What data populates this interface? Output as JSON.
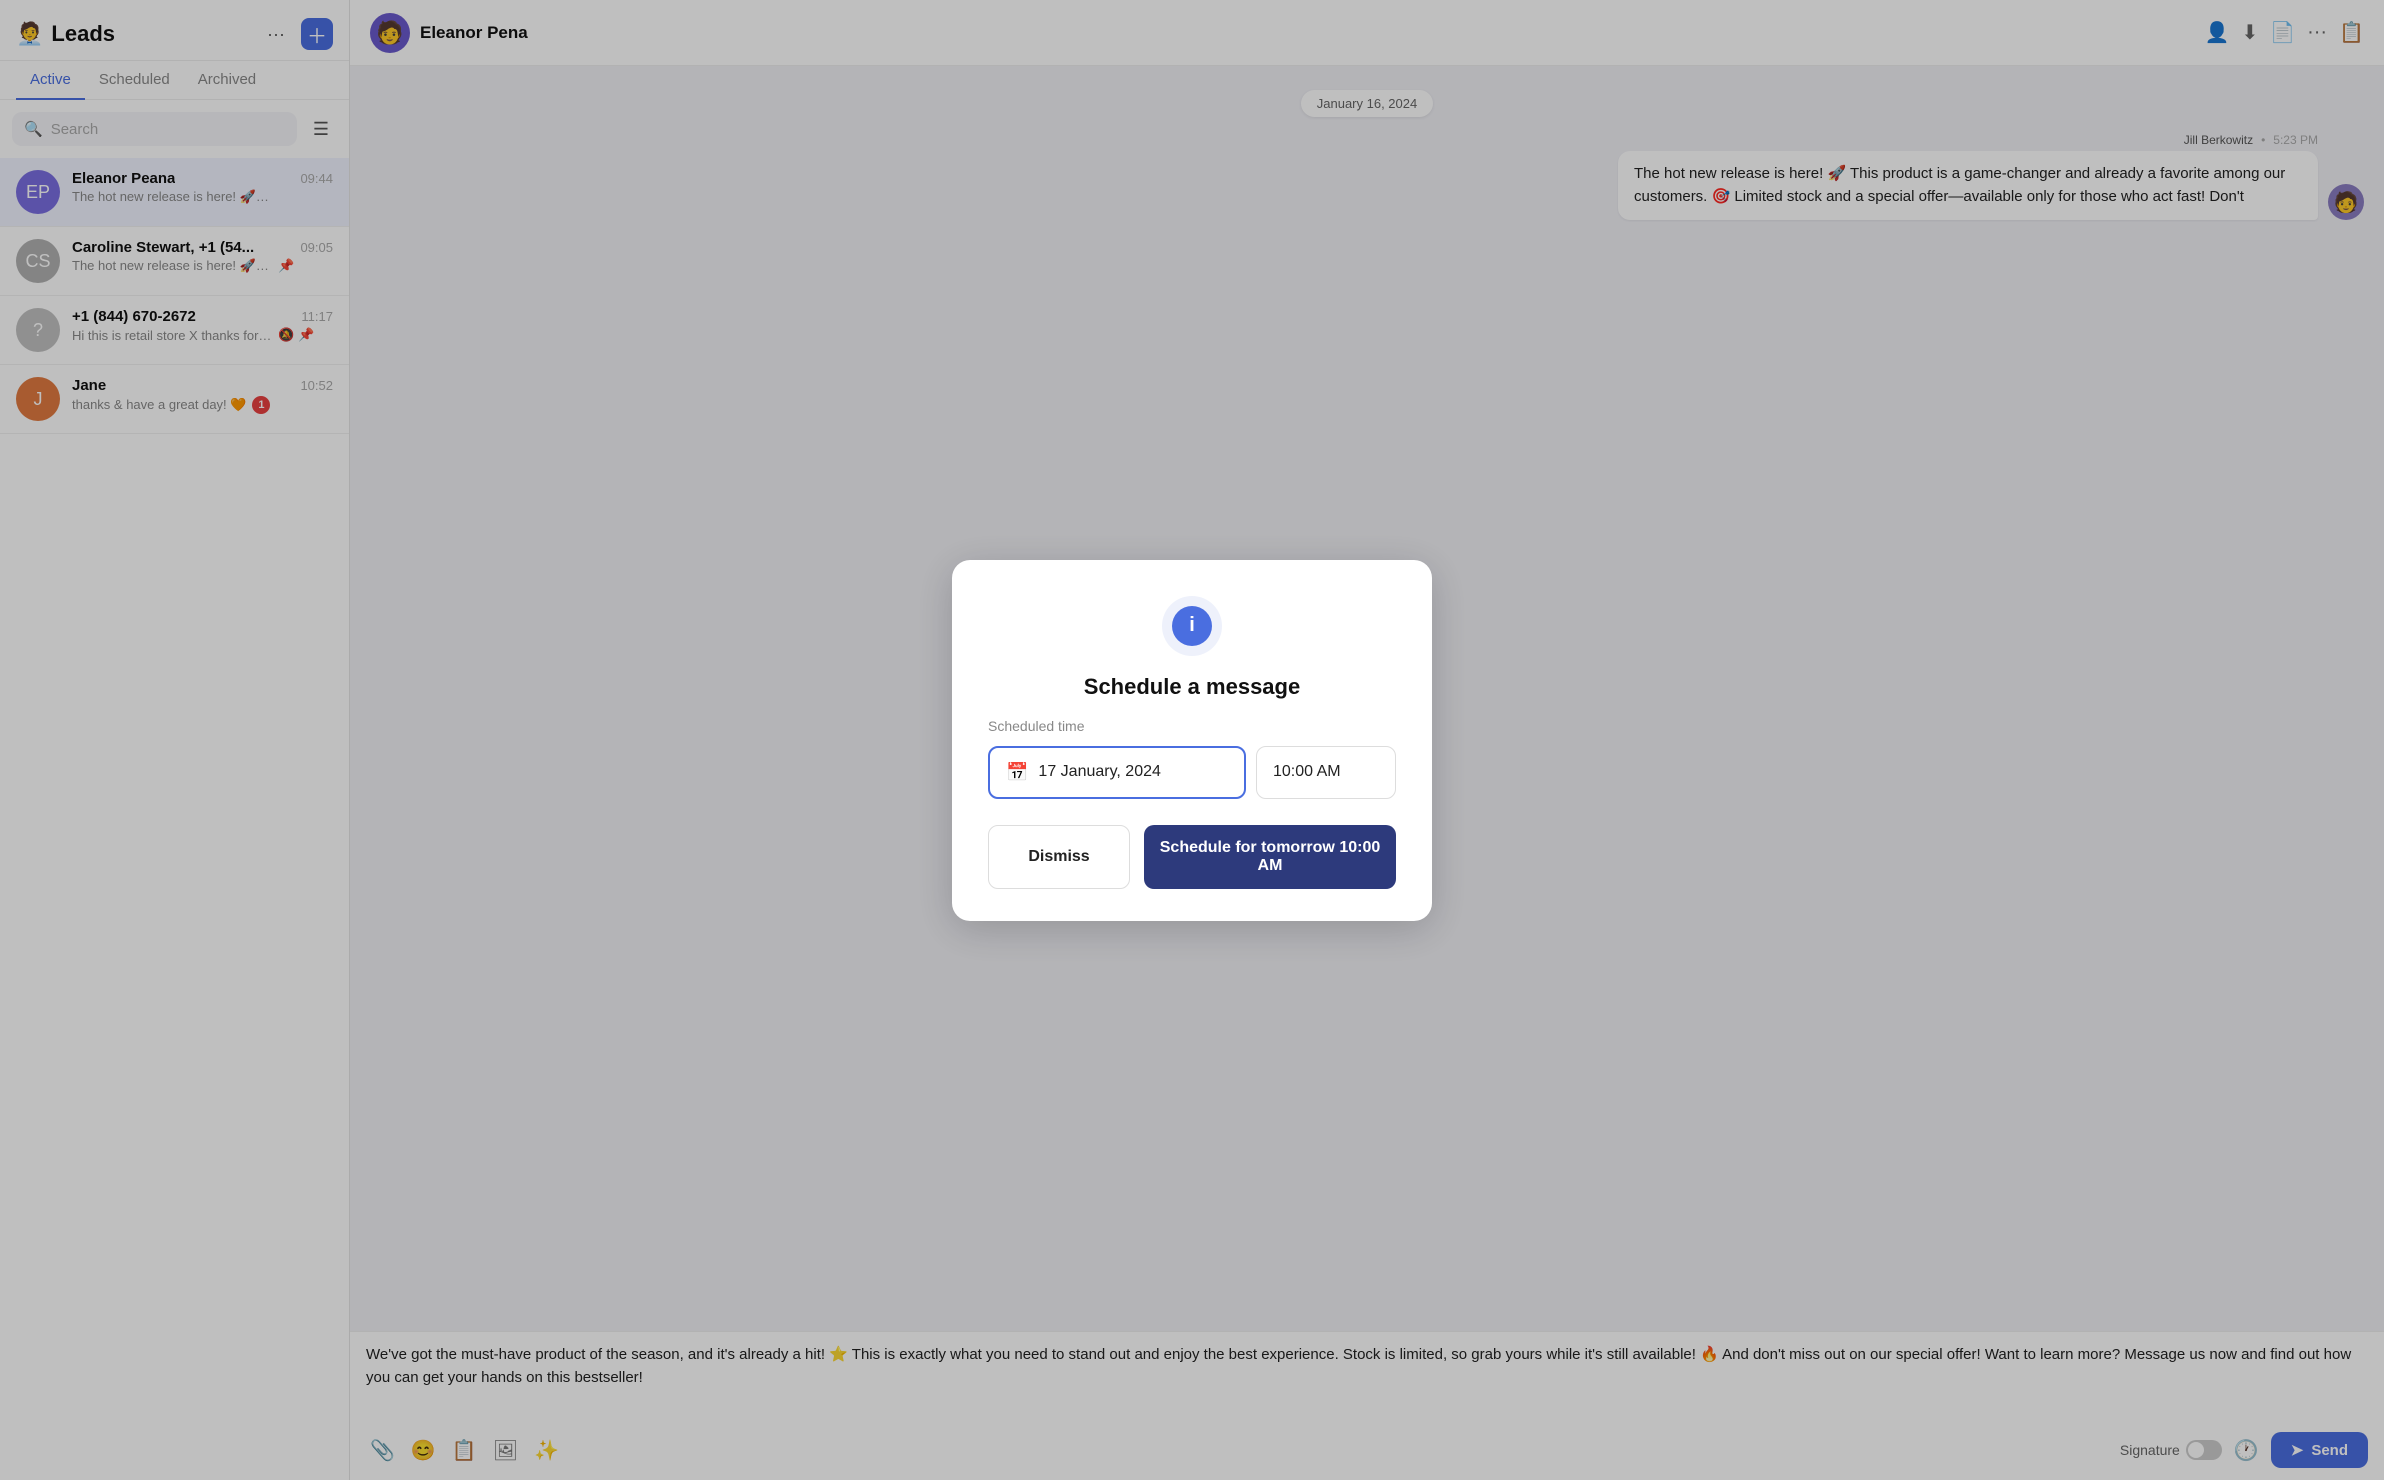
{
  "app": {
    "title": "Leads",
    "emoji": "🧑‍💼"
  },
  "sidebar": {
    "tabs": [
      {
        "id": "active",
        "label": "Active",
        "active": true
      },
      {
        "id": "scheduled",
        "label": "Scheduled",
        "active": false
      },
      {
        "id": "archived",
        "label": "Archived",
        "active": false
      }
    ],
    "search": {
      "placeholder": "Search"
    },
    "contacts": [
      {
        "id": "eleanor",
        "name": "Eleanor Peana",
        "time": "09:44",
        "preview": "The hot new release is here! 🚀 This product is a game-changer and alr...",
        "selected": true,
        "muted": false,
        "pinned": false,
        "badge": null,
        "avatarColor": "#7a6ee0",
        "avatarInitial": "EP"
      },
      {
        "id": "caroline",
        "name": "Caroline Stewart, +1 (54...",
        "time": "09:05",
        "preview": "The hot new release is here! 🚀 This product is a game-chang...",
        "selected": false,
        "muted": false,
        "pinned": true,
        "badge": null,
        "avatarColor": "#b0b0b0",
        "avatarInitial": "CS"
      },
      {
        "id": "phone1",
        "name": "+1 (844) 670-2672",
        "time": "11:17",
        "preview": "Hi this is retail store X thanks for contacting us. Stdrd rates...",
        "selected": false,
        "muted": true,
        "pinned": true,
        "badge": null,
        "avatarColor": "#c0c0c0",
        "avatarInitial": "?"
      },
      {
        "id": "jane",
        "name": "Jane",
        "time": "10:52",
        "preview": "thanks & have a great day! 🧡",
        "selected": false,
        "muted": false,
        "pinned": false,
        "badge": "1",
        "avatarColor": "#e07a40",
        "avatarInitial": "J"
      }
    ]
  },
  "header": {
    "contact_name": "Eleanor Pena",
    "avatar_emoji": "👤",
    "icons": [
      "person-icon",
      "download-icon",
      "file-icon",
      "more-icon",
      "layout-icon"
    ]
  },
  "chat": {
    "date_separator": "January 16, 2024",
    "messages": [
      {
        "id": "msg1",
        "sender": "Jill Berkowitz",
        "time": "5:23 PM",
        "text": "The hot new release is here! 🚀 This product is a game-changer and already a favorite among our customers. 🎯 Limited stock and a special offer—available only for those who act fast! Don't",
        "side": "right"
      }
    ]
  },
  "compose": {
    "text": "We've got the must-have product of the season, and it's already a hit! ⭐ This is exactly what you need to stand out and enjoy the best experience. Stock is limited, so grab yours while it's still available! 🔥 And don't miss out on our special offer! Want to learn more?\n\nMessage us now and find out how you can get your hands on this bestseller!",
    "signature_label": "Signature",
    "send_label": "Send",
    "icons": {
      "attachment": "📎",
      "emoji": "😊",
      "note": "📋",
      "media": "🖼",
      "magic": "✨"
    }
  },
  "modal": {
    "title": "Schedule a message",
    "field_label": "Scheduled time",
    "date_value": "17 January, 2024",
    "time_value": "10:00 AM",
    "dismiss_label": "Dismiss",
    "schedule_label": "Schedule for tomorrow 10:00 AM"
  }
}
